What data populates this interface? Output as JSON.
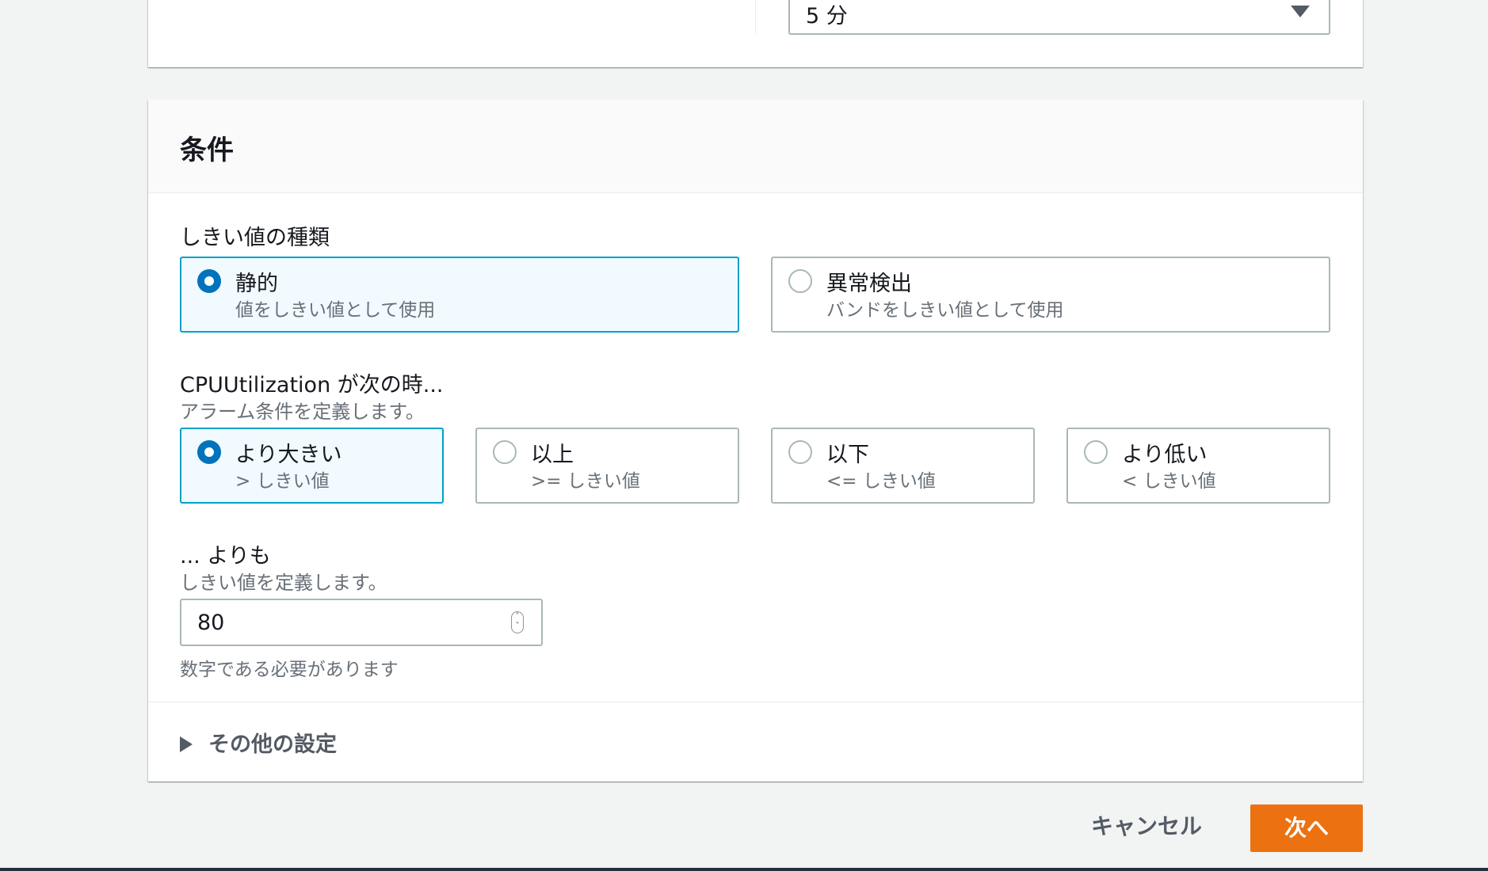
{
  "period": {
    "value": "5 分"
  },
  "conditions": {
    "title": "条件",
    "threshold_type": {
      "label": "しきい値の種類",
      "options": [
        {
          "title": "静的",
          "desc": "値をしきい値として使用",
          "selected": true
        },
        {
          "title": "異常検出",
          "desc": "バンドをしきい値として使用",
          "selected": false
        }
      ]
    },
    "condition": {
      "label": "CPUUtilization が次の時...",
      "desc": "アラーム条件を定義します。",
      "options": [
        {
          "title": "より大きい",
          "desc": "> しきい値",
          "selected": true
        },
        {
          "title": "以上",
          "desc": ">= しきい値",
          "selected": false
        },
        {
          "title": "以下",
          "desc": "<= しきい値",
          "selected": false
        },
        {
          "title": "より低い",
          "desc": "< しきい値",
          "selected": false
        }
      ]
    },
    "threshold": {
      "label": "... よりも",
      "desc": "しきい値を定義します。",
      "value": "80",
      "hint": "数字である必要があります"
    },
    "additional": {
      "label": "その他の設定"
    }
  },
  "footer": {
    "cancel": "キャンセル",
    "next": "次へ"
  }
}
